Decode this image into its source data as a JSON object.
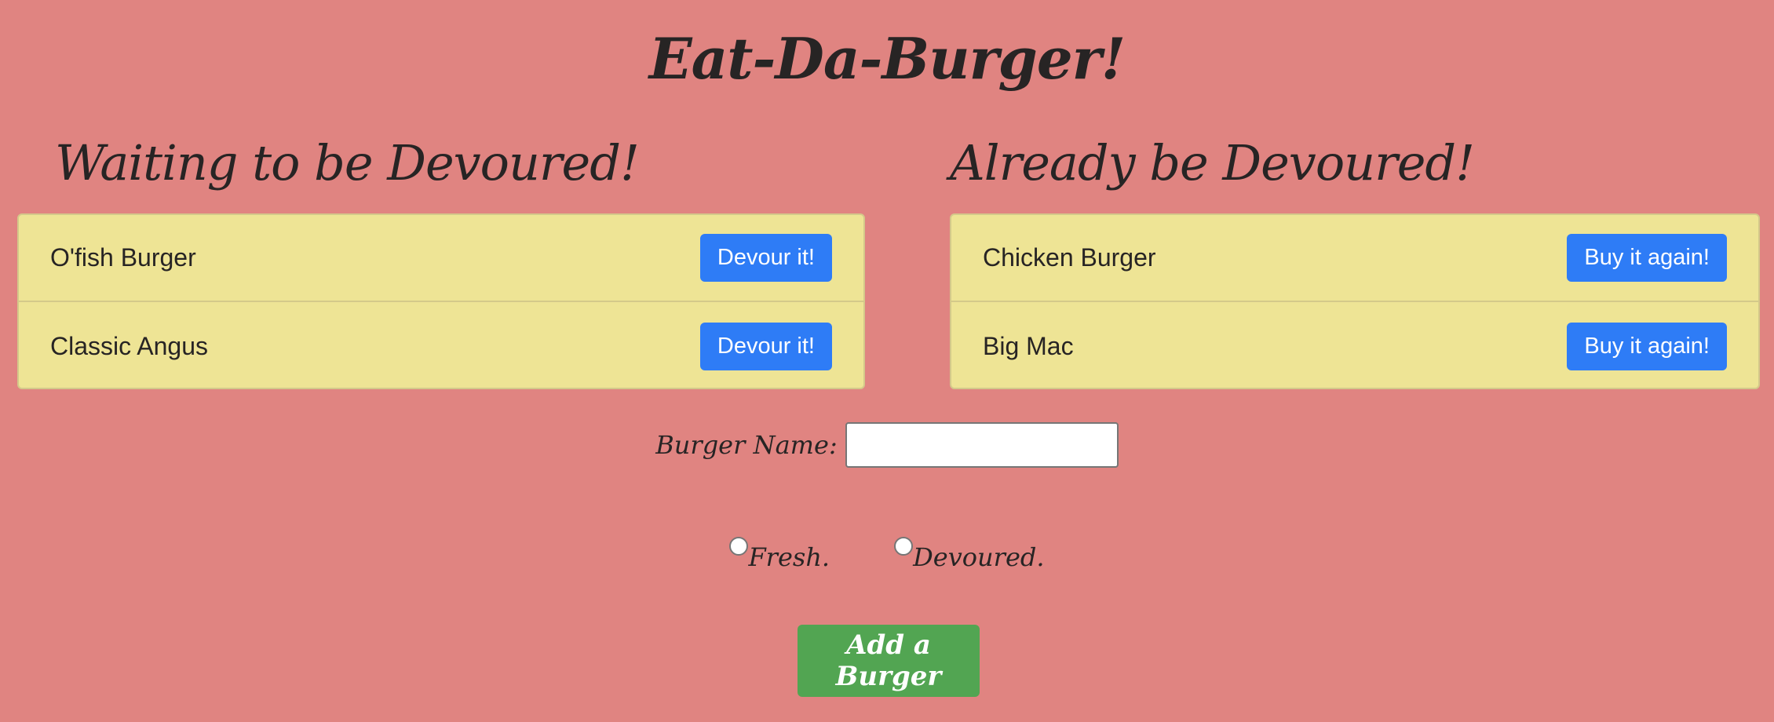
{
  "title": "Eat-Da-Burger!",
  "waiting": {
    "heading": "Waiting to be Devoured!",
    "items": [
      {
        "name": "O'fish Burger",
        "button": "Devour it!"
      },
      {
        "name": "Classic Angus",
        "button": "Devour it!"
      }
    ]
  },
  "devoured": {
    "heading": "Already be Devoured!",
    "items": [
      {
        "name": "Chicken Burger",
        "button": "Buy it again!"
      },
      {
        "name": "Big Mac",
        "button": "Buy it again!"
      }
    ]
  },
  "form": {
    "name_label": "Burger Name:",
    "name_value": "",
    "options": [
      "Fresh.",
      "Devoured."
    ],
    "submit_label": "Add a Burger"
  },
  "colors": {
    "background": "#e08481",
    "panel": "#eee495",
    "button_blue": "#2e7cf6",
    "button_green": "#52a552"
  }
}
